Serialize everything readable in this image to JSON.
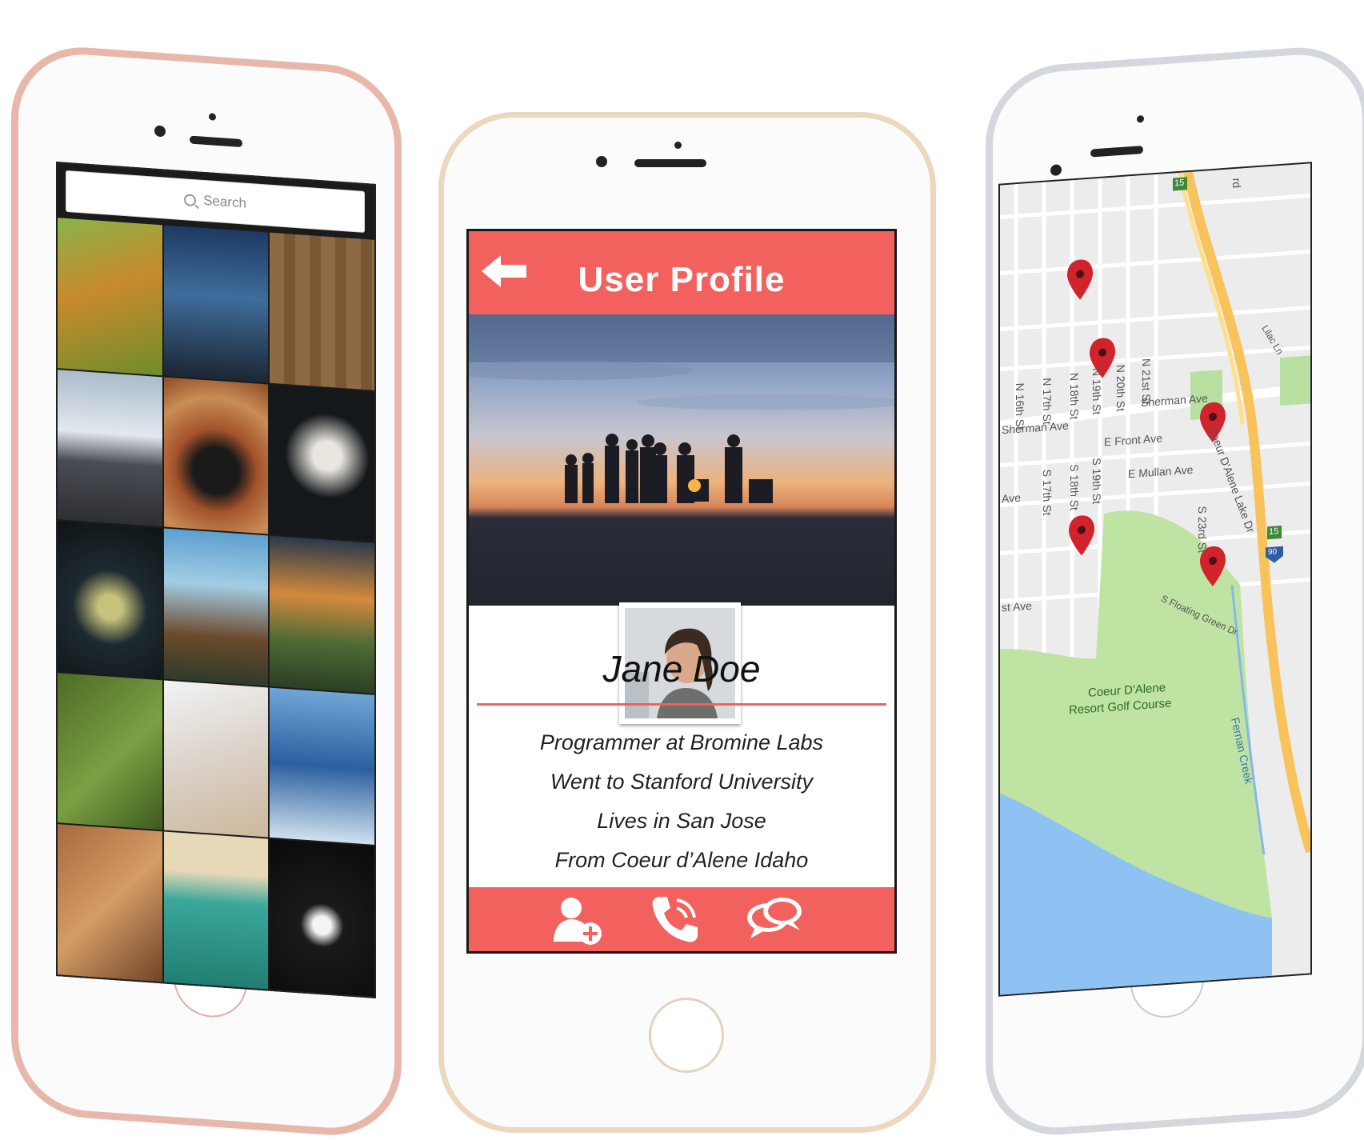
{
  "left_screen": {
    "search_placeholder": "Search",
    "photos": [
      "lion",
      "mountains-dusk",
      "wooden-planks-ice-cream",
      "road",
      "canyon-bend",
      "swan",
      "jellyfish",
      "lake-trees",
      "cliff-sunset",
      "green-field",
      "flower-hand",
      "blue-mountains",
      "wood-arches",
      "vintage-car",
      "geometric-web"
    ]
  },
  "profile": {
    "title": "User Profile",
    "name": "Jane Doe",
    "bio": [
      "Programmer at Bromine Labs",
      "Went to Stanford University",
      "Lives in San Jose",
      "From Coeur d’Alene Idaho"
    ],
    "accent_color": "#f2615e",
    "icons": {
      "back": "back-arrow-icon",
      "add_contact": "add-contact-icon",
      "call": "phone-icon",
      "message": "chat-bubbles-icon"
    }
  },
  "map": {
    "streets": [
      "N 16th St",
      "N 17th St",
      "N 18th St",
      "N 19th St",
      "N 20th St",
      "N 21st St",
      "S 17th St",
      "S 18th St",
      "S 19th St",
      "S 23rd St",
      "Sherman Ave",
      "E Front Ave",
      "E Mullan Ave",
      "Coeur D'Alene Lake Dr",
      "S Floating Green Dr",
      "Lilac Ln",
      "Fernan Creek"
    ],
    "partial_labels": [
      "rd",
      "st Ave",
      "Ave"
    ],
    "places": [
      "Coeur D'Alene",
      "Resort Golf Course"
    ],
    "highway_shields": [
      "15",
      "15",
      "90"
    ],
    "pin_count": 5,
    "pin_color": "#d0232b"
  }
}
